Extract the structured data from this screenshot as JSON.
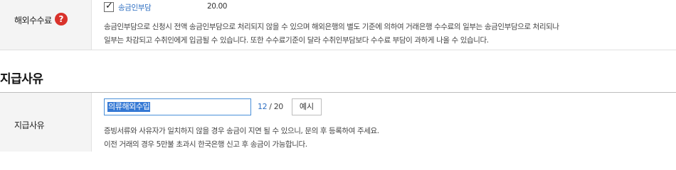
{
  "fee_row": {
    "label": "해외수수료",
    "help_glyph": "?",
    "help_icon": "question-circle-icon",
    "help_color": "#d9322b",
    "checkbox_checked": true,
    "option_label": "송금인부담",
    "option_value": "20.00",
    "desc_line1": "송금인부담으로 신청시 전액 송금인부담으로 처리되지 않을 수 있으며 해외은행의 별도 기준에 의하여 거래은행 수수료의 일부는 송금인부담으로 처리되나",
    "desc_line2": "일부는 차감되고 수취인에게 입금될 수 있습니다. 또한 수수료기준이 달라 수취인부담보다 수수료 부담이 과하게 나올 수 있습니다."
  },
  "section": {
    "title": "지급사유"
  },
  "reason_row": {
    "label": "지급사유",
    "input_value": "의류해외수입",
    "counter_current": "12",
    "counter_separator": " / ",
    "counter_max": "20",
    "example_button": "예시",
    "notice_line1": "증빙서류와 사유자가 일치하지 않을 경우 송금이 지연 될 수 있으니, 문의 후 등록하여 주세요.",
    "notice_line2": "이전 거래의 경우 5만불 초과시 한국은행 신고 후 송금이 가능합니다."
  },
  "colors": {
    "accent_blue": "#2f6fc2",
    "selection_blue": "#3478d4",
    "label_bg": "#f4f4f4"
  }
}
